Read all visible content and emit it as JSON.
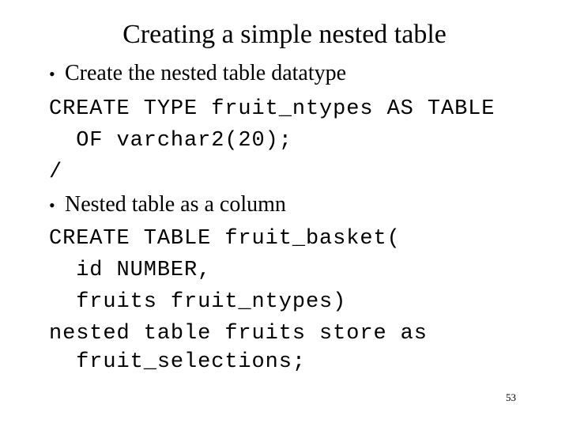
{
  "slide": {
    "title": "Creating a simple nested table",
    "page_number": "53",
    "background_color": "#ffffff",
    "text_color": "#000000",
    "bullets": [
      {
        "marker": "•",
        "text": "Create the nested table datatype"
      },
      {
        "marker": "•",
        "text": "Nested table as a column"
      }
    ],
    "code_block_1": {
      "lines": [
        "CREATE TYPE fruit_ntypes AS TABLE",
        "  OF varchar2(20);",
        "/"
      ]
    },
    "code_block_2": {
      "lines": [
        "CREATE TABLE fruit_basket(",
        "  id NUMBER,",
        "  fruits fruit_ntypes)",
        "nested table fruits store as",
        "  fruit_selections;"
      ]
    }
  }
}
